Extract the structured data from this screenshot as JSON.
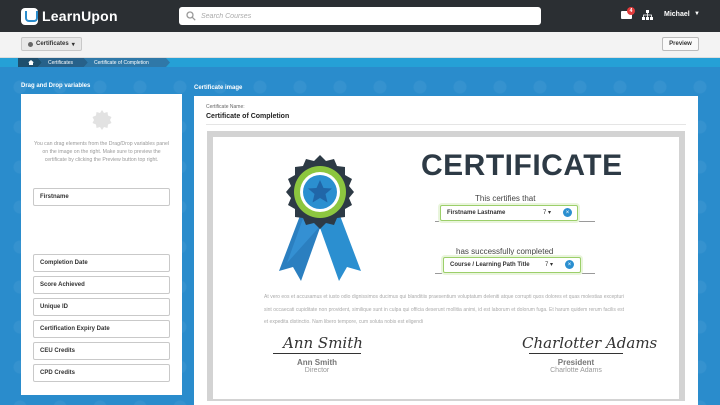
{
  "app": {
    "name": "LearnUpon"
  },
  "search": {
    "placeholder": "Search Courses"
  },
  "header": {
    "notification_count": "4",
    "user_name": "Michael"
  },
  "toolbar": {
    "certificates_label": "Certificates",
    "preview_label": "Preview"
  },
  "breadcrumb": {
    "items": [
      "Certificates",
      "Certificate of Completion"
    ]
  },
  "left_panel": {
    "title": "Drag and Drop variables",
    "help_text": "You can drag elements from the Drag/Drop variables panel on the image on the right. Make sure to preview the certificate by clicking the Preview button top right.",
    "variables": [
      "Firstname",
      "Completion Date",
      "Score Achieved",
      "Unique ID",
      "Certification Expiry Date",
      "CEU Credits",
      "CPD Credits"
    ]
  },
  "right_panel": {
    "title": "Certificate image",
    "name_label": "Certificate Name:",
    "name_value": "Certificate of Completion"
  },
  "certificate": {
    "heading": "CERTIFICATE",
    "certifies_text": "This certifies that",
    "name_variable": "Firstname Lastname",
    "name_font_size": "7",
    "completed_text": "has successfully completed",
    "course_variable": "Course / Learning Path Title",
    "course_font_size": "7",
    "body_text": "At vero eos et accusamus et iusto odio dignissimos ducimus qui blanditiis praesentium voluptatum deleniti atque corrupti quos dolores et quas molestias excepturi sint occaecati cupiditate non provident, similique sunt in culpa qui officia deserunt mollitia animi, id est laborum et dolorum fuga. Et harum quidem rerum facilis est et expedita distinctio. Nam libero tempore, cum soluta nobis est eligendi",
    "signatures": [
      {
        "signature": "Ann Smith",
        "name": "Ann Smith",
        "role": "Director"
      },
      {
        "signature": "Charlotter Adams",
        "name": "President",
        "role": "Charlotte Adams"
      }
    ]
  },
  "colors": {
    "brand_blue": "#2a8ccc",
    "topbar": "#2b2f33",
    "ribbon_blue": "#2b8fd0",
    "medal_green": "#8cc63f",
    "heading": "#2d3a45"
  }
}
